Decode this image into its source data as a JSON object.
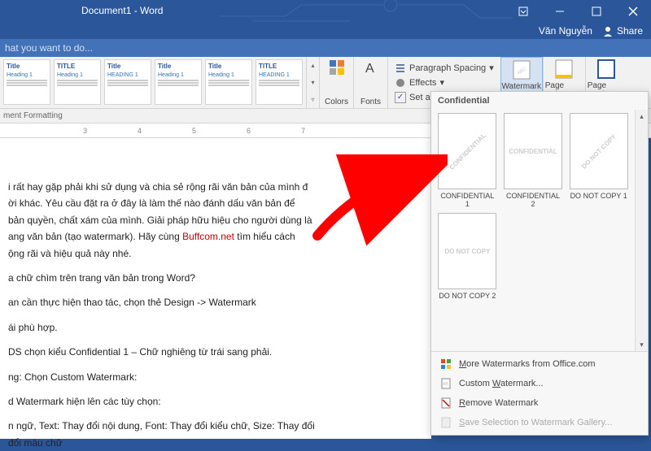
{
  "window": {
    "title": "Document1 - Word"
  },
  "sharebar": {
    "user": "Văn Nguyễn",
    "share": "Share"
  },
  "tellme": {
    "placeholder": "hat you want to do..."
  },
  "ribbon": {
    "styles": [
      {
        "title": "Title",
        "sub": "Heading 1"
      },
      {
        "title": "TITLE",
        "sub": "Heading 1"
      },
      {
        "title": "Title",
        "sub": "HEADING 1"
      },
      {
        "title": "Title",
        "sub": "Heading 1"
      },
      {
        "title": "Title",
        "sub": "Heading 1"
      },
      {
        "title": "TITLE",
        "sub": "HEADING 1"
      }
    ],
    "colors": "Colors",
    "fonts": "Fonts",
    "para": {
      "spacing": "Paragraph Spacing",
      "effects": "Effects",
      "setdefault": "Set as Default"
    },
    "pagebkg": {
      "watermark": "Watermark",
      "pagecolor": "Page Color",
      "pageborders": "Page Borders"
    }
  },
  "fmtbar": "ment Formatting",
  "ruler": [
    "",
    "3",
    "4",
    "5",
    "6",
    "7"
  ],
  "document": {
    "p1a": "i rất hay gặp phải khi sử dụng và chia sẻ rộng rãi văn bản của mình đ",
    "p1b": "ời khác. Yêu cầu đặt ra ở đây là làm thế nào đánh dấu văn bản để",
    "p1c": "bản quyền, chất xám của mình. Giải pháp hữu hiệu cho người dùng là",
    "p1d_pre": "ang văn bản (tạo watermark). Hãy cùng ",
    "p1d_link": "Buffcom.net",
    "p1d_post": " tìm hiểu cách",
    "p1e": "ộng rãi và hiệu quả này nhé.",
    "p2": "a chữ chìm trên trang văn bản trong Word?",
    "p3": "an cần thực hiện thao tác, chọn thẻ Design -> Watermark",
    "p4": "ái phù hợp.",
    "p5": "DS chọn kiểu Confidential 1 – Chữ nghiêng từ trái sang phải.",
    "p6": "ng: Chọn Custom Watermark:",
    "p7": "d Watermark hiện lên các tùy chọn:",
    "p8a": "n ngữ, Text: Thay đổi nội dung, Font: Thay đổi kiểu chữ, Size: Thay đổi",
    "p8b": "đổi màu chữ"
  },
  "watermark_menu": {
    "header": "Confidential",
    "items": [
      {
        "text": "CONFIDENTIAL",
        "label": "CONFIDENTIAL 1",
        "diag": true
      },
      {
        "text": "CONFIDENTIAL",
        "label": "CONFIDENTIAL 2",
        "diag": false
      },
      {
        "text": "DO NOT COPY",
        "label": "DO NOT COPY 1",
        "diag": true
      },
      {
        "text": "DO NOT COPY",
        "label": "DO NOT COPY 2",
        "diag": false
      }
    ],
    "more": "More Watermarks from Office.com",
    "custom": "Custom Watermark...",
    "remove": "Remove Watermark",
    "save": "Save Selection to Watermark Gallery..."
  }
}
